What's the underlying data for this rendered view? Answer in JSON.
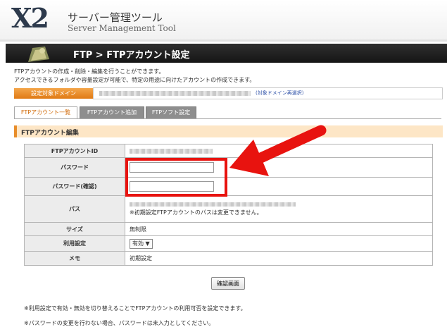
{
  "header": {
    "logo": "X2",
    "title_jp": "サーバー管理ツール",
    "title_en": "Server Management Tool"
  },
  "titlebar": {
    "title": "FTP > FTPアカウント設定",
    "icon": "folder-key-icon"
  },
  "description": [
    "FTPアカウントの作成・削除・編集を行うことができます。",
    "アクセスできるフォルダや容量設定が可能で、特定の用途に向けたアカウントの作成できます。"
  ],
  "domain": {
    "button_label": "設定対象ドメイン",
    "reselect_link": "(対象ドメイン再選択)"
  },
  "tabs": [
    {
      "label": "FTPアカウント一覧",
      "active": true
    },
    {
      "label": "FTPアカウント追加",
      "active": false
    },
    {
      "label": "FTPソフト設定",
      "active": false
    }
  ],
  "section_title": "FTPアカウント編集",
  "form": {
    "account_id_label": "FTPアカウントID",
    "password_label": "パスワード",
    "password_value": "",
    "password_confirm_label": "パスワード(確認)",
    "password_confirm_value": "",
    "path_label": "パス",
    "path_note": "※初期設定FTPアカウントのパスは変更できません。",
    "size_label": "サイズ",
    "size_value": "無制限",
    "usage_label": "利用設定",
    "usage_selected": "有効",
    "memo_label": "メモ",
    "memo_value": "初期設定"
  },
  "confirm_button": "確認画面",
  "notes": [
    "※利用設定で有効・無効を切り替えることでFTPアカウントの利用可否を設定できます。",
    "※パスワードの変更を行わない場合、パスワードは未入力としてください。"
  ],
  "colors": {
    "accent_orange": "#e88d2a",
    "titlebar_dark": "#1e1e1e",
    "highlight_red": "#e8130f"
  }
}
